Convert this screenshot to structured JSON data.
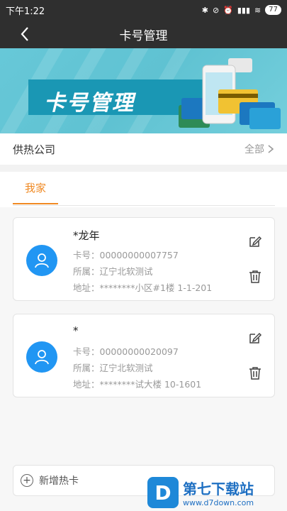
{
  "status": {
    "time": "下午1:22",
    "battery": "77"
  },
  "nav": {
    "title": "卡号管理"
  },
  "banner": {
    "text": "卡号管理"
  },
  "company": {
    "label": "供热公司",
    "value": "全部"
  },
  "tabs": [
    {
      "label": "我家"
    }
  ],
  "cards": [
    {
      "name": "*龙年",
      "card_no": "卡号：00000000007757",
      "belongs": "所属：辽宁北软测试",
      "address": "地址：********小区#1楼 1-1-201"
    },
    {
      "name": "*",
      "card_no": "卡号：00000000020097",
      "belongs": "所属：辽宁北软测试",
      "address": "地址：********试大楼 10-1601"
    }
  ],
  "add": {
    "label": "新增热卡"
  },
  "watermark": {
    "main": "第七下载站",
    "sub": "www.d7down.com",
    "logo": "D"
  }
}
